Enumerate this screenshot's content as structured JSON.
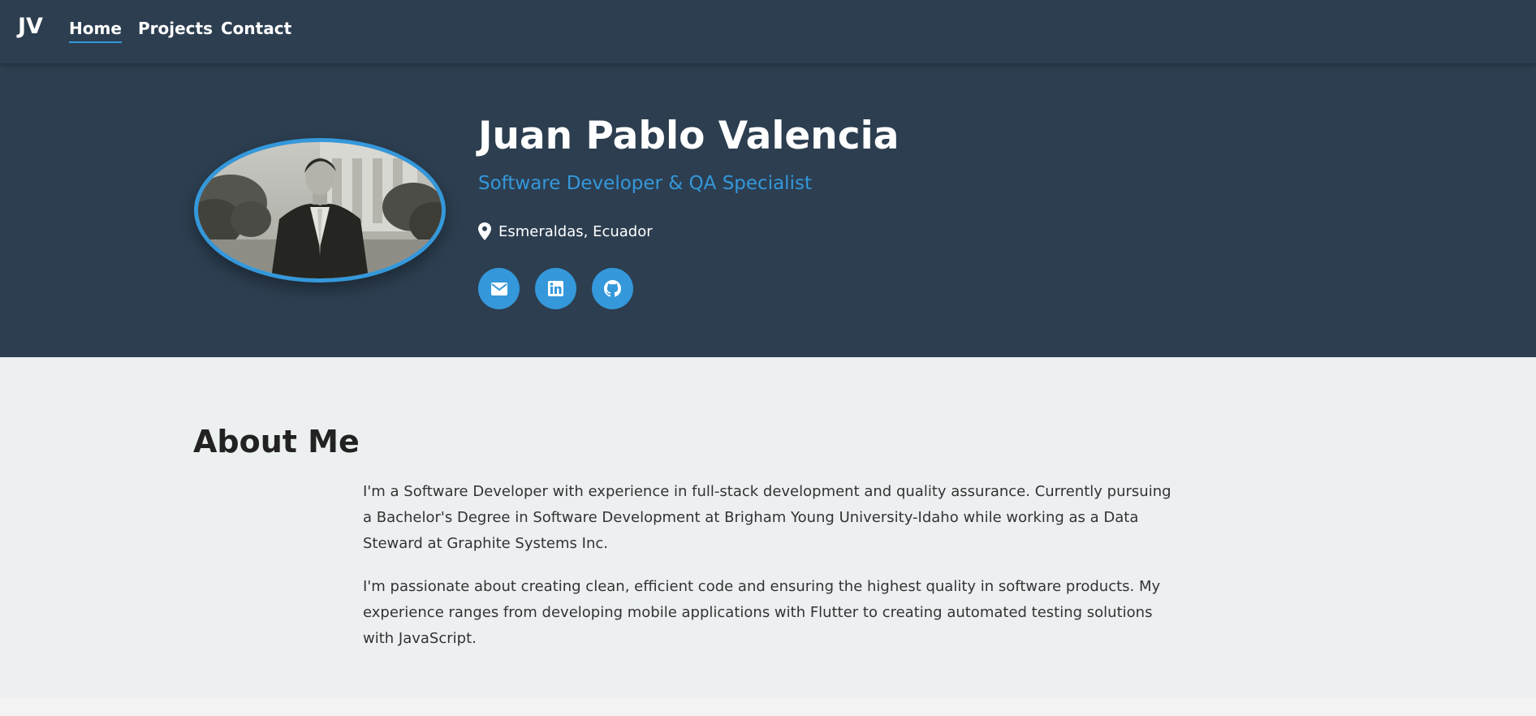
{
  "nav": {
    "brand": "JV",
    "links": [
      "Home",
      "Projects",
      "Contact"
    ],
    "active": "Home"
  },
  "hero": {
    "name": "Juan Pablo Valencia",
    "subtitle": "Software Developer & QA Specialist",
    "location": "Esmeraldas, Ecuador",
    "social": [
      "envelope-icon",
      "linkedin-icon",
      "github-icon"
    ]
  },
  "about": {
    "title": "About Me",
    "paragraphs": [
      "I'm a Software Developer with experience in full-stack development and quality assurance. Currently pursuing a Bachelor's Degree in Software Development at Brigham Young University-Idaho while working as a Data Steward at Graphite Systems Inc.",
      "I'm passionate about creating clean, efficient code and ensuring the highest quality in software products. My experience ranges from developing mobile applications with Flutter to creating automated testing solutions with JavaScript."
    ]
  },
  "colors": {
    "header_bg": "#2c3e50",
    "accent": "#3498db",
    "about_bg": "#ecf0f1",
    "footer_bg": "#f3f3f3"
  }
}
